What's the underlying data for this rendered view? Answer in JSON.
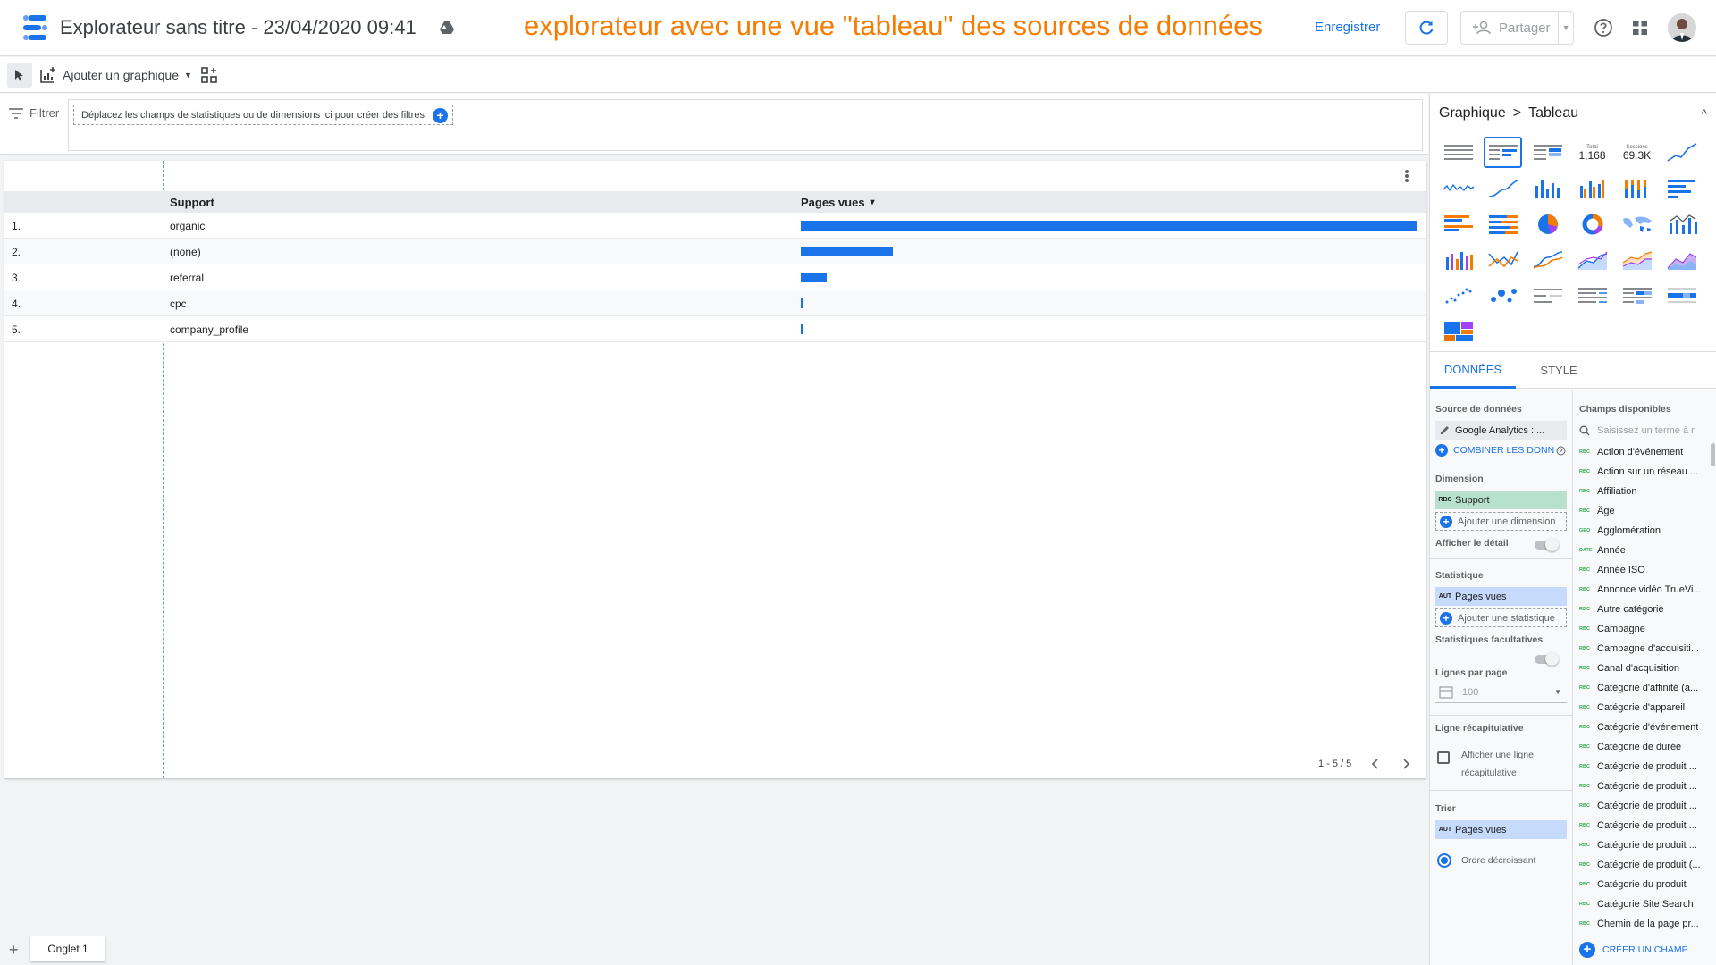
{
  "header": {
    "title": "Explorateur sans titre - 23/04/2020 09:41",
    "annotation": "explorateur avec une vue \"tableau\" des sources de données",
    "save_label": "Enregistrer",
    "share_label": "Partager"
  },
  "toolbar": {
    "add_chart_label": "Ajouter un graphique"
  },
  "filter": {
    "label": "Filtrer",
    "hint": "Déplacez les champs de statistiques ou de dimensions ici pour créer des filtres"
  },
  "table": {
    "columns": [
      "Support",
      "Pages vues"
    ],
    "sort_indicator": "▾",
    "rows": [
      {
        "index": "1.",
        "support": "organic",
        "value_fraction": 1.0
      },
      {
        "index": "2.",
        "support": "(none)",
        "value_fraction": 0.149
      },
      {
        "index": "3.",
        "support": "referral",
        "value_fraction": 0.042
      },
      {
        "index": "4.",
        "support": "cpc",
        "value_fraction": 0.002
      },
      {
        "index": "5.",
        "support": "company_profile",
        "value_fraction": 0.002
      }
    ],
    "pagination": "1 - 5 / 5"
  },
  "pages": {
    "add_label": "+",
    "tab_label": "Onglet 1"
  },
  "panel": {
    "breadcrumb_parent": "Graphique",
    "breadcrumb_separator": ">",
    "breadcrumb_current": "Tableau",
    "chart_type_samples": {
      "total_label": "Total",
      "total_value": "1,168",
      "sessions_label": "Sessions",
      "sessions_value": "69.3K"
    },
    "tabs": {
      "data": "DONNÉES",
      "style": "STYLE"
    },
    "data_source": {
      "title": "Source de données",
      "value": "Google Analytics : ...",
      "blend_label": "COMBINER LES DONN"
    },
    "dimension": {
      "title": "Dimension",
      "tag": "RBC",
      "value": "Support",
      "add_label": "Ajouter une dimension",
      "drill_label": "Afficher le détail"
    },
    "metric": {
      "title": "Statistique",
      "tag": "AUT",
      "value": "Pages vues",
      "add_label": "Ajouter une statistique",
      "optional_label": "Statistiques facultatives"
    },
    "rows_per_page": {
      "title": "Lignes par page",
      "value": "100"
    },
    "summary_row": {
      "title": "Ligne récapitulative",
      "checkbox_label_line1": "Afficher une ligne",
      "checkbox_label_line2": "récapitulative"
    },
    "sort": {
      "title": "Trier",
      "tag": "AUT",
      "value": "Pages vues",
      "order_label": "Ordre décroissant"
    },
    "fields": {
      "title": "Champs disponibles",
      "search_placeholder": "Saisissez un terme à r",
      "create_label": "CRÉER UN CHAMP",
      "items": [
        {
          "tag": "RBC",
          "name": "Action d'événement"
        },
        {
          "tag": "RBC",
          "name": "Action sur un réseau ..."
        },
        {
          "tag": "RBC",
          "name": "Affiliation"
        },
        {
          "tag": "RBC",
          "name": "Âge"
        },
        {
          "tag": "GEO",
          "name": "Agglomération"
        },
        {
          "tag": "DATE",
          "name": "Année"
        },
        {
          "tag": "RBC",
          "name": "Année ISO"
        },
        {
          "tag": "RBC",
          "name": "Annonce vidéo TrueVi..."
        },
        {
          "tag": "RBC",
          "name": "Autre catégorie"
        },
        {
          "tag": "RBC",
          "name": "Campagne"
        },
        {
          "tag": "RBC",
          "name": "Campagne d'acquisiti..."
        },
        {
          "tag": "RBC",
          "name": "Canal d'acquisition"
        },
        {
          "tag": "RBC",
          "name": "Catégorie d'affinité (a..."
        },
        {
          "tag": "RBC",
          "name": "Catégorie d'appareil"
        },
        {
          "tag": "RBC",
          "name": "Catégorie d'événement"
        },
        {
          "tag": "RBC",
          "name": "Catégorie de durée"
        },
        {
          "tag": "RBC",
          "name": "Catégorie de produit ..."
        },
        {
          "tag": "RBC",
          "name": "Catégorie de produit ..."
        },
        {
          "tag": "RBC",
          "name": "Catégorie de produit ..."
        },
        {
          "tag": "RBC",
          "name": "Catégorie de produit ..."
        },
        {
          "tag": "RBC",
          "name": "Catégorie de produit ..."
        },
        {
          "tag": "RBC",
          "name": "Catégorie de produit (..."
        },
        {
          "tag": "RBC",
          "name": "Catégorie du produit"
        },
        {
          "tag": "RBC",
          "name": "Catégorie Site Search"
        },
        {
          "tag": "RBC",
          "name": "Chemin de la page pr..."
        }
      ]
    }
  },
  "colors": {
    "accent": "#1a73e8",
    "annotation": "#f57c00",
    "dimension_chip": "#b7e1cd",
    "metric_chip": "#c6dafc"
  }
}
